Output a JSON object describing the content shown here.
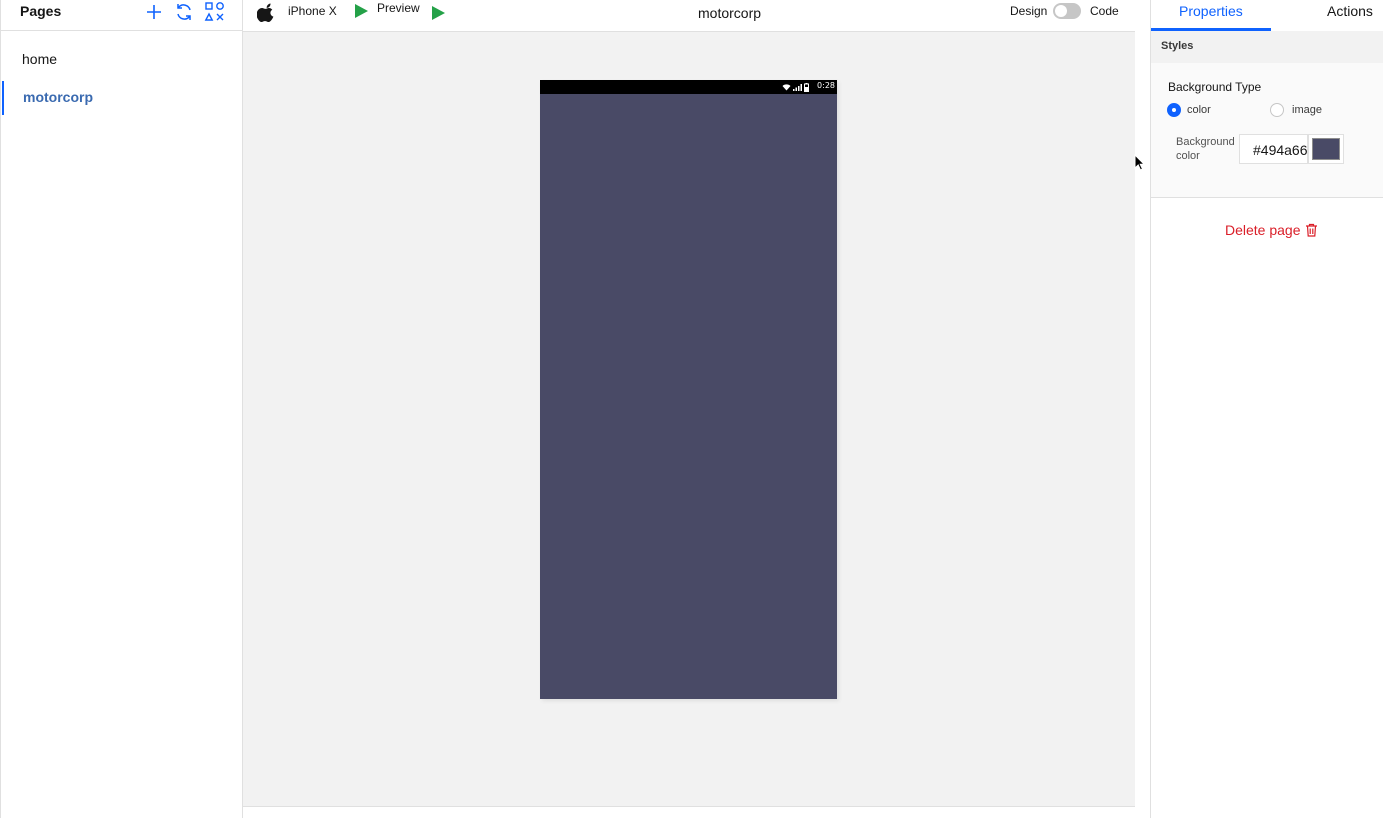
{
  "sidebar": {
    "title": "Pages",
    "icons": [
      "plus-icon",
      "refresh-icon",
      "components-icon"
    ],
    "pages": [
      {
        "label": "home",
        "active": false
      },
      {
        "label": "motorcorp",
        "active": true
      }
    ]
  },
  "toolbar": {
    "platform_icon": "apple-icon",
    "device": "iPhone X",
    "preview_label": "Preview",
    "page_name": "motorcorp",
    "design_label": "Design",
    "code_label": "Code",
    "mode_toggle_on": false
  },
  "phone": {
    "background_color": "#494a66",
    "status_time": "0:28"
  },
  "panel": {
    "tabs": [
      {
        "label": "Properties",
        "active": true
      },
      {
        "label": "Actions",
        "active": false
      }
    ],
    "section_title": "Styles",
    "background_type_label": "Background Type",
    "background_type_options": [
      {
        "label": "color",
        "checked": true
      },
      {
        "label": "image",
        "checked": false
      }
    ],
    "background_color_label": "Background color",
    "background_color_value": "#494a66",
    "delete_label": "Delete page"
  },
  "colors": {
    "accent": "#0f62fe",
    "active_page_text": "#3a6ab0",
    "play_green": "#24a148",
    "danger": "#da1e28",
    "canvas_bg": "#f2f2f2"
  }
}
